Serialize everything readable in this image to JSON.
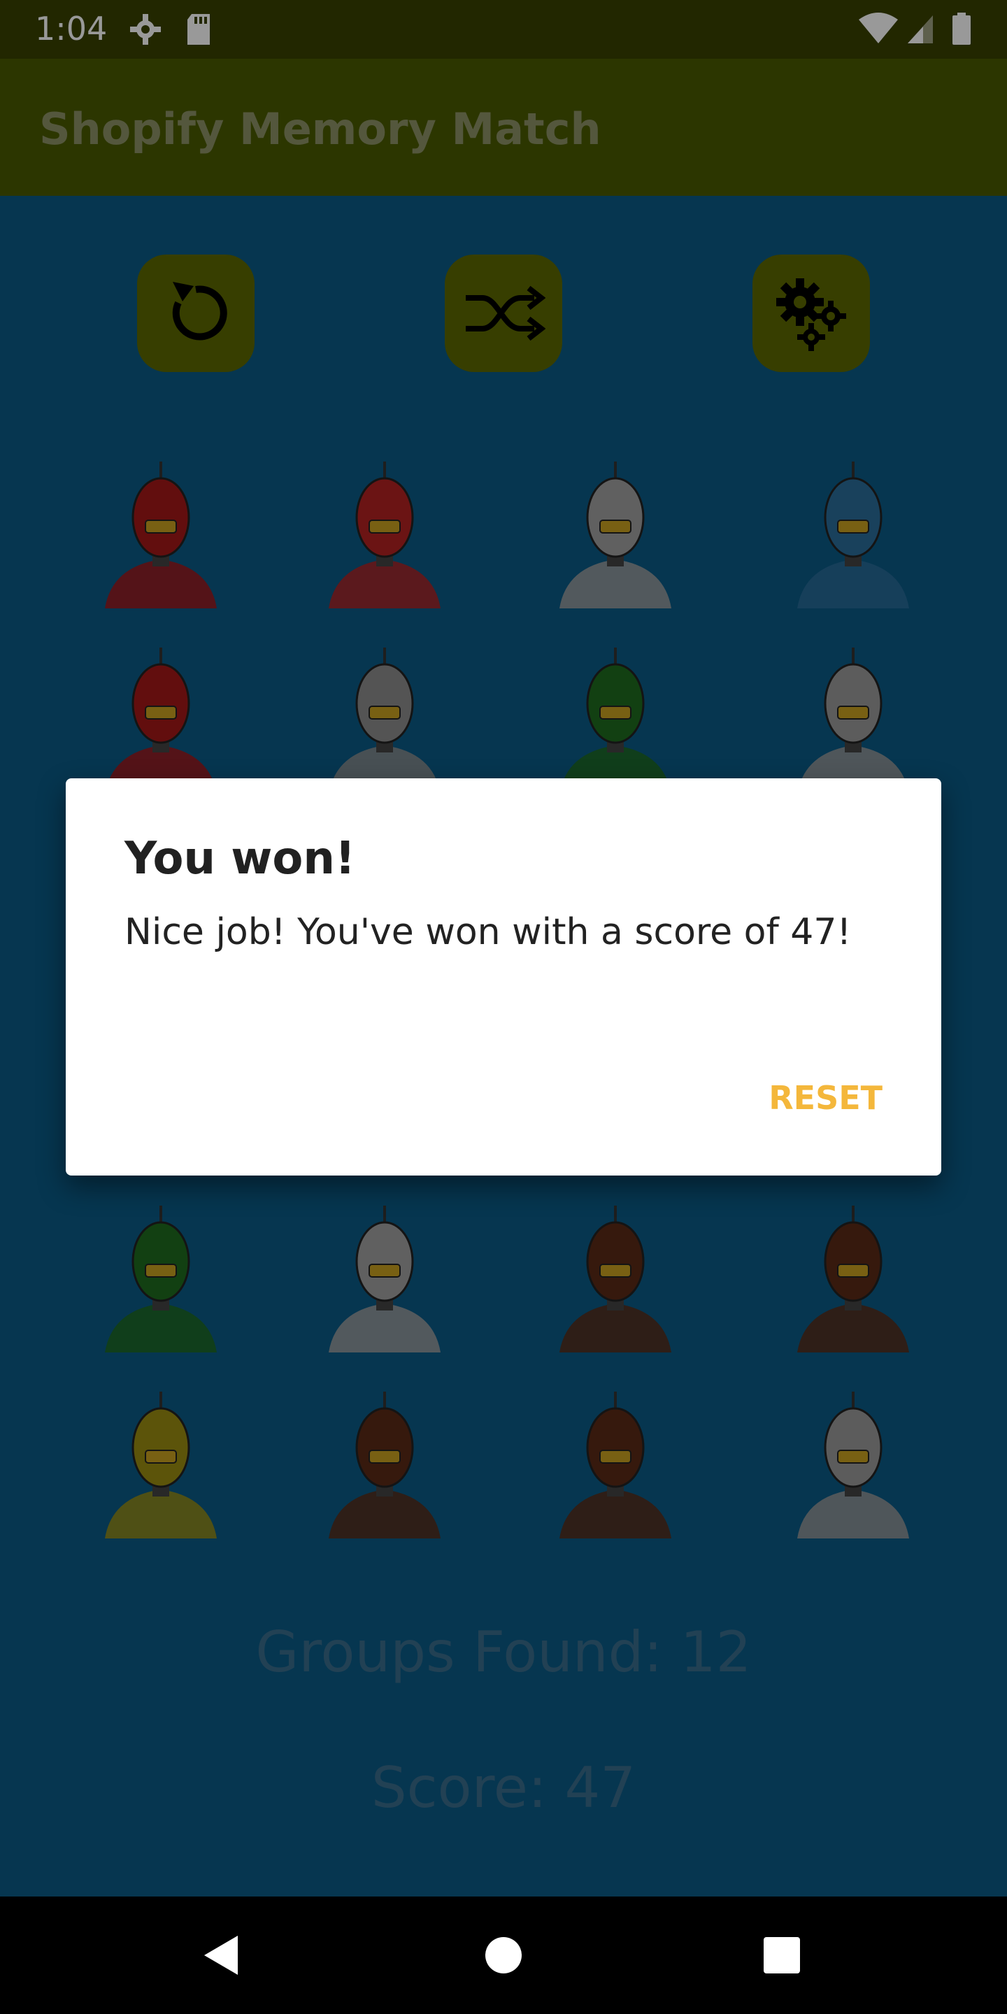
{
  "status_bar": {
    "time": "1:04",
    "icons": [
      "gear-icon",
      "sdcard-icon",
      "wifi-icon",
      "signal-icon",
      "battery-icon"
    ]
  },
  "app_bar": {
    "title": "Shopify Memory Match"
  },
  "controls": [
    {
      "name": "reset-button",
      "icon": "restart-icon"
    },
    {
      "name": "shuffle-button",
      "icon": "shuffle-icon"
    },
    {
      "name": "settings-button",
      "icon": "gears-icon"
    }
  ],
  "cards": [
    {
      "row": 0,
      "col": 0,
      "color": "#a31818"
    },
    {
      "row": 0,
      "col": 1,
      "color": "#b22222"
    },
    {
      "row": 0,
      "col": 2,
      "color": "#a0a0a0"
    },
    {
      "row": 0,
      "col": 3,
      "color": "#2a6d9a"
    },
    {
      "row": 1,
      "col": 0,
      "color": "#a31818"
    },
    {
      "row": 1,
      "col": 1,
      "color": "#8d8d8d"
    },
    {
      "row": 1,
      "col": 2,
      "color": "#1f6b1f"
    },
    {
      "row": 1,
      "col": 3,
      "color": "#9a9a9a"
    },
    {
      "row": 4,
      "col": 0,
      "color": "#1f6b1f"
    },
    {
      "row": 4,
      "col": 1,
      "color": "#a0a0a0"
    },
    {
      "row": 4,
      "col": 2,
      "color": "#5a2b16"
    },
    {
      "row": 4,
      "col": 3,
      "color": "#5a2b16"
    },
    {
      "row": 5,
      "col": 0,
      "color": "#9a8d12"
    },
    {
      "row": 5,
      "col": 1,
      "color": "#5a2b16"
    },
    {
      "row": 5,
      "col": 2,
      "color": "#5a2b16"
    },
    {
      "row": 5,
      "col": 3,
      "color": "#9a9a9a"
    }
  ],
  "stats": {
    "groups": "Groups Found: 12",
    "score": "Score: 47"
  },
  "dialog": {
    "title": "You won!",
    "message": "Nice job! You've won with a score of 47!",
    "button": "RESET"
  },
  "nav": [
    "back-icon",
    "home-icon",
    "recents-icon"
  ]
}
